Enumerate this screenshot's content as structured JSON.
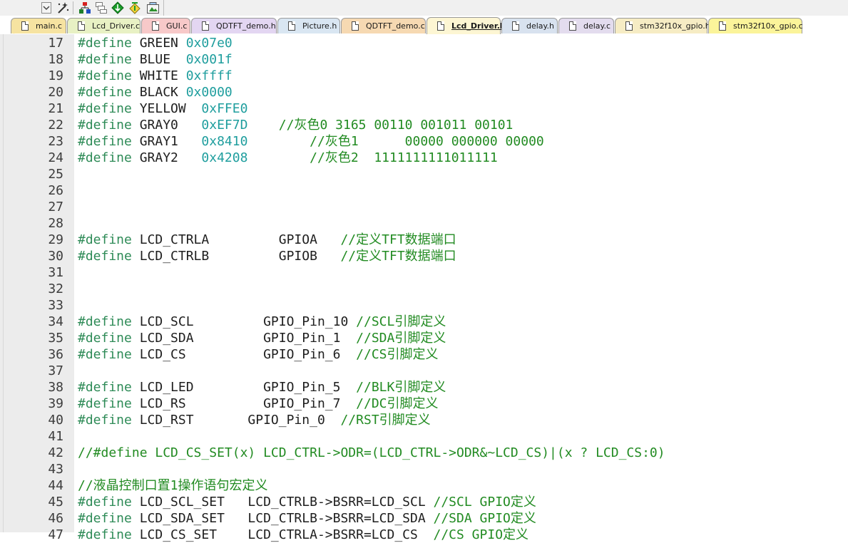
{
  "toolbar": {
    "buttons": [
      {
        "icon": "dropdown-arrow-icon"
      },
      {
        "icon": "magic-wand-icon"
      },
      {
        "icon": "manage-project-icon"
      },
      {
        "icon": "window-layout-icon"
      },
      {
        "icon": "diamond-download-icon"
      },
      {
        "icon": "flash-diamond-icon"
      },
      {
        "icon": "packs-installer-icon"
      }
    ]
  },
  "tabs": [
    {
      "label": "main.c",
      "color": "#f6e3a1"
    },
    {
      "label": "Lcd_Driver.c",
      "color": "#e8f1c4"
    },
    {
      "label": "GUI.c",
      "color": "#f7c9c9"
    },
    {
      "label": "QDTFT_demo.h",
      "color": "#e3d6f2"
    },
    {
      "label": "Picture.h",
      "color": "#d9e6f2"
    },
    {
      "label": "QDTFT_demo.c",
      "color": "#f6d9b2"
    },
    {
      "label": "Lcd_Driver.h",
      "color": "#fdf6d3",
      "active": true
    },
    {
      "label": "delay.h",
      "color": "#d8e2ef"
    },
    {
      "label": "delay.c",
      "color": "#e3dcee"
    },
    {
      "label": "stm32f10x_gpio.h",
      "color": "#f6ecc4"
    },
    {
      "label": "stm32f10x_gpio.c",
      "color": "#fbf49a"
    }
  ],
  "colors": {
    "keyword": "#2e8b57",
    "number": "#1f9e9e",
    "comment": "#228b22",
    "identifier": "#1e1e1e",
    "gutter": "#ececec",
    "active_tab": "#fdf6d3"
  },
  "editor": {
    "lines": [
      {
        "n": "17",
        "parts": [
          [
            "kw",
            "#define"
          ],
          [
            "id",
            " GREEN "
          ],
          [
            "num",
            "0x07e0"
          ]
        ]
      },
      {
        "n": "18",
        "parts": [
          [
            "kw",
            "#define"
          ],
          [
            "id",
            " BLUE  "
          ],
          [
            "num",
            "0x001f"
          ]
        ]
      },
      {
        "n": "19",
        "parts": [
          [
            "kw",
            "#define"
          ],
          [
            "id",
            " WHITE "
          ],
          [
            "num",
            "0xffff"
          ]
        ]
      },
      {
        "n": "20",
        "parts": [
          [
            "kw",
            "#define"
          ],
          [
            "id",
            " BLACK "
          ],
          [
            "num",
            "0x0000"
          ]
        ]
      },
      {
        "n": "21",
        "parts": [
          [
            "kw",
            "#define"
          ],
          [
            "id",
            " YELLOW  "
          ],
          [
            "num",
            "0xFFE0"
          ]
        ]
      },
      {
        "n": "22",
        "parts": [
          [
            "kw",
            "#define"
          ],
          [
            "id",
            " GRAY0   "
          ],
          [
            "num",
            "0xEF7D"
          ],
          [
            "id",
            "    "
          ],
          [
            "cm",
            "//灰色0 3165 00110 001011 00101"
          ]
        ]
      },
      {
        "n": "23",
        "parts": [
          [
            "kw",
            "#define"
          ],
          [
            "id",
            " GRAY1   "
          ],
          [
            "num",
            "0x8410"
          ],
          [
            "id",
            "        "
          ],
          [
            "cm",
            "//灰色1      00000 000000 00000"
          ]
        ]
      },
      {
        "n": "24",
        "parts": [
          [
            "kw",
            "#define"
          ],
          [
            "id",
            " GRAY2   "
          ],
          [
            "num",
            "0x4208"
          ],
          [
            "id",
            "        "
          ],
          [
            "cm",
            "//灰色2  1111111111011111"
          ]
        ]
      },
      {
        "n": "25",
        "parts": []
      },
      {
        "n": "26",
        "parts": []
      },
      {
        "n": "27",
        "parts": []
      },
      {
        "n": "28",
        "parts": []
      },
      {
        "n": "29",
        "parts": [
          [
            "kw",
            "#define"
          ],
          [
            "id",
            " LCD_CTRLA         GPIOA   "
          ],
          [
            "cm",
            "//定义TFT数据端口"
          ]
        ]
      },
      {
        "n": "30",
        "parts": [
          [
            "kw",
            "#define"
          ],
          [
            "id",
            " LCD_CTRLB         GPIOB   "
          ],
          [
            "cm",
            "//定义TFT数据端口"
          ]
        ]
      },
      {
        "n": "31",
        "parts": []
      },
      {
        "n": "32",
        "parts": []
      },
      {
        "n": "33",
        "parts": []
      },
      {
        "n": "34",
        "parts": [
          [
            "kw",
            "#define"
          ],
          [
            "id",
            " LCD_SCL         GPIO_Pin_10 "
          ],
          [
            "cm",
            "//SCL引脚定义"
          ]
        ]
      },
      {
        "n": "35",
        "parts": [
          [
            "kw",
            "#define"
          ],
          [
            "id",
            " LCD_SDA         GPIO_Pin_1  "
          ],
          [
            "cm",
            "//SDA引脚定义"
          ]
        ]
      },
      {
        "n": "36",
        "parts": [
          [
            "kw",
            "#define"
          ],
          [
            "id",
            " LCD_CS          GPIO_Pin_6  "
          ],
          [
            "cm",
            "//CS引脚定义"
          ]
        ]
      },
      {
        "n": "37",
        "parts": []
      },
      {
        "n": "38",
        "parts": [
          [
            "kw",
            "#define"
          ],
          [
            "id",
            " LCD_LED         GPIO_Pin_5  "
          ],
          [
            "cm",
            "//BLK引脚定义"
          ]
        ]
      },
      {
        "n": "39",
        "parts": [
          [
            "kw",
            "#define"
          ],
          [
            "id",
            " LCD_RS          GPIO_Pin_7  "
          ],
          [
            "cm",
            "//DC引脚定义"
          ]
        ]
      },
      {
        "n": "40",
        "parts": [
          [
            "kw",
            "#define"
          ],
          [
            "id",
            " LCD_RST       GPIO_Pin_0  "
          ],
          [
            "cm",
            "//RST引脚定义"
          ]
        ]
      },
      {
        "n": "41",
        "parts": []
      },
      {
        "n": "42",
        "parts": [
          [
            "cm",
            "//#define LCD_CS_SET(x) LCD_CTRL->ODR=(LCD_CTRL->ODR&~LCD_CS)|(x ? LCD_CS:0)"
          ]
        ]
      },
      {
        "n": "43",
        "parts": []
      },
      {
        "n": "44",
        "parts": [
          [
            "cm",
            "//液晶控制口置1操作语句宏定义"
          ]
        ]
      },
      {
        "n": "45",
        "parts": [
          [
            "kw",
            "#define"
          ],
          [
            "id",
            " LCD_SCL_SET   LCD_CTRLB->BSRR=LCD_SCL "
          ],
          [
            "cm",
            "//SCL GPIO定义"
          ]
        ]
      },
      {
        "n": "46",
        "parts": [
          [
            "kw",
            "#define"
          ],
          [
            "id",
            " LCD_SDA_SET   LCD_CTRLB->BSRR=LCD_SDA "
          ],
          [
            "cm",
            "//SDA GPIO定义"
          ]
        ]
      },
      {
        "n": "47",
        "parts": [
          [
            "kw",
            "#define"
          ],
          [
            "id",
            " LCD_CS_SET    LCD_CTRLA->BSRR=LCD_CS  "
          ],
          [
            "cm",
            "//CS GPIO定义"
          ]
        ]
      }
    ]
  }
}
